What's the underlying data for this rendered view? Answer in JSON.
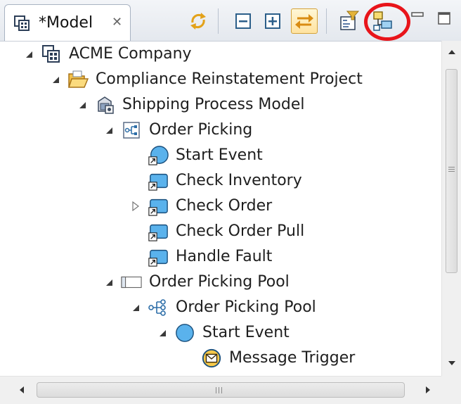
{
  "view": {
    "tab_title": "*Model",
    "close_glyph": "✕"
  },
  "toolbar": {
    "buttons": [
      {
        "name": "sync-icon"
      },
      {
        "name": "collapse-all-icon"
      },
      {
        "name": "expand-all-icon"
      },
      {
        "name": "link-with-editor-icon",
        "state": "on"
      },
      {
        "name": "filter-icon"
      },
      {
        "name": "hierarchy-view-icon",
        "highlighted": true
      },
      {
        "name": "minimize-icon"
      },
      {
        "name": "maximize-icon"
      }
    ]
  },
  "tree": {
    "rows": [
      {
        "label": "ACME Company",
        "icon": "company-icon",
        "expanded": true
      },
      {
        "label": "Compliance Reinstatement Project",
        "icon": "folder-open-icon",
        "expanded": true
      },
      {
        "label": "Shipping Process Model",
        "icon": "process-model-icon",
        "expanded": true
      },
      {
        "label": "Order Picking",
        "icon": "diagram-icon",
        "expanded": true
      },
      {
        "label": "Start Event",
        "icon": "start-event-shortcut-icon"
      },
      {
        "label": "Check Inventory",
        "icon": "task-shortcut-icon"
      },
      {
        "label": "Check Order",
        "icon": "task-shortcut-icon",
        "expanded": false
      },
      {
        "label": "Check Order Pull",
        "icon": "task-shortcut-icon"
      },
      {
        "label": "Handle Fault",
        "icon": "task-shortcut-icon"
      },
      {
        "label": "Order Picking Pool",
        "icon": "pool-icon",
        "expanded": true
      },
      {
        "label": "Order Picking Pool",
        "icon": "process-icon",
        "expanded": true
      },
      {
        "label": "Start Event",
        "icon": "start-event-icon",
        "expanded": true
      },
      {
        "label": "Message Trigger",
        "icon": "message-trigger-icon"
      }
    ]
  },
  "scrollbars": {
    "horizontal_grip": "III"
  }
}
